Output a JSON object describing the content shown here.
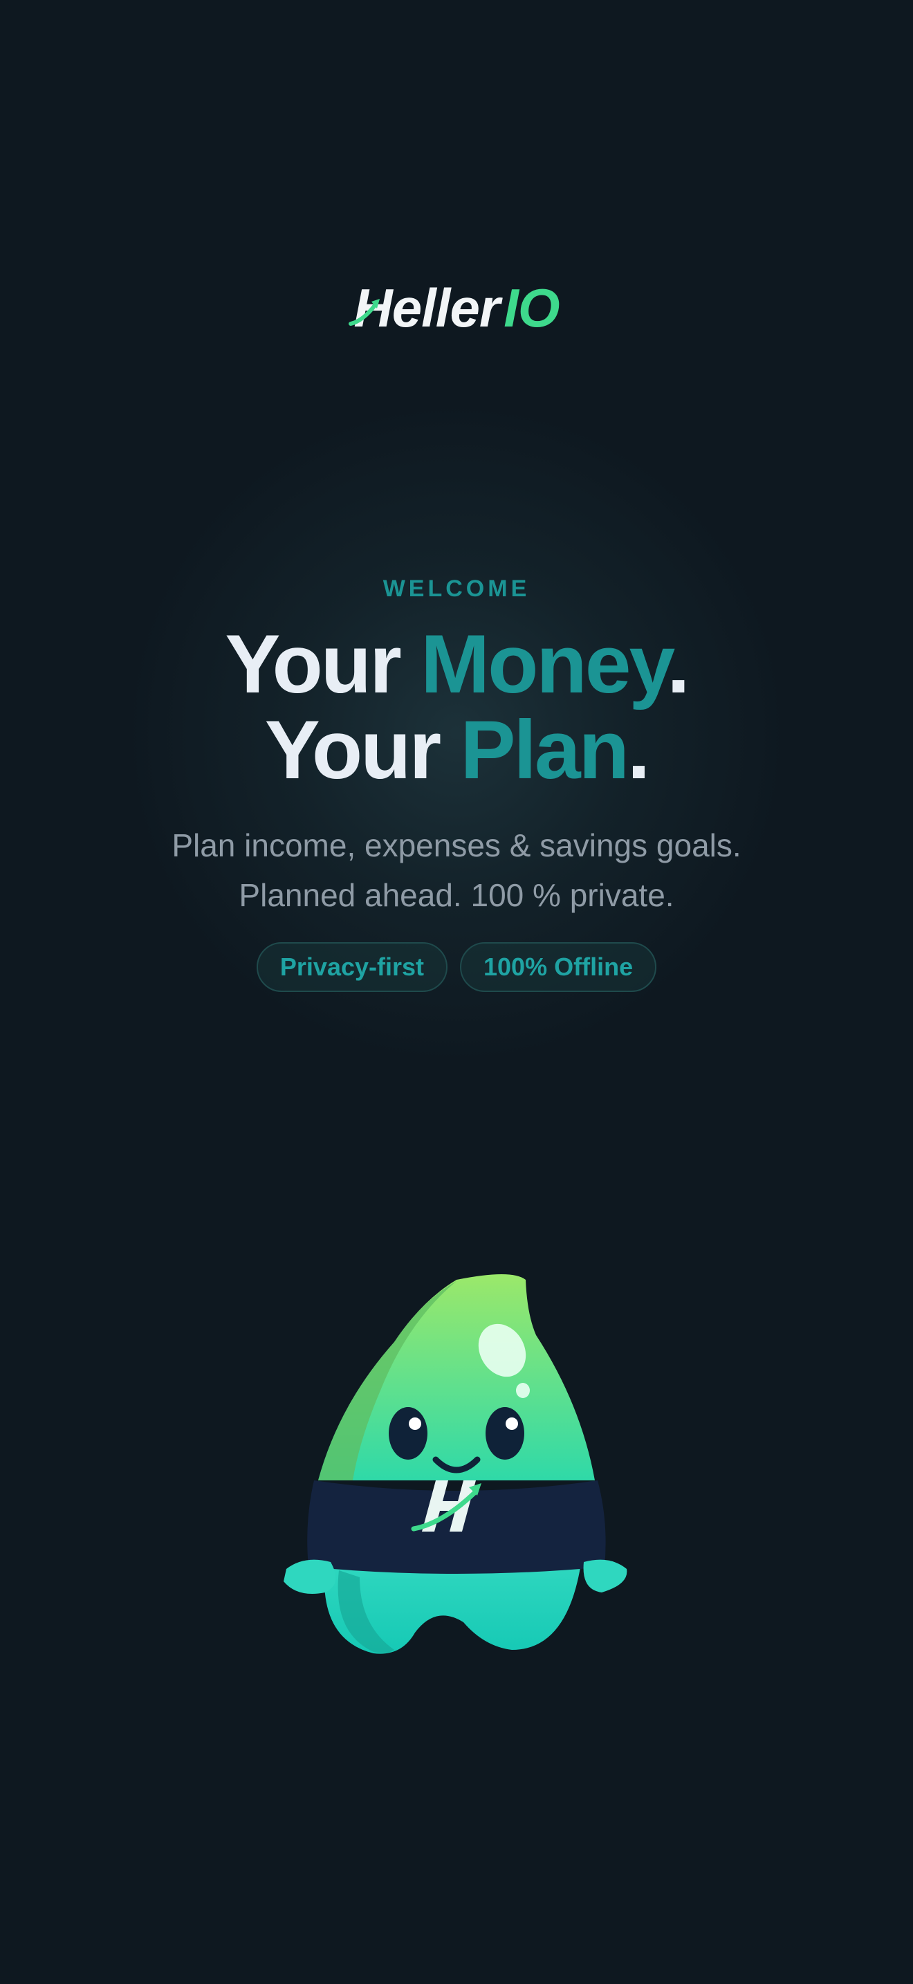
{
  "brand": {
    "name_part1": "Heller",
    "name_part2": "IO"
  },
  "hero": {
    "eyebrow": "WELCOME",
    "line1_word1": "Your",
    "line1_word2": "Money",
    "line1_dot": ".",
    "line2_word1": "Your",
    "line2_word2": "Plan",
    "line2_dot": ".",
    "subtitle_line1": "Plan income, expenses & savings goals.",
    "subtitle_line2": "Planned ahead. 100 % private."
  },
  "chips": [
    {
      "label": "Privacy-first"
    },
    {
      "label": "100% Offline"
    }
  ],
  "mascot": {
    "shirt_mark": "H"
  },
  "colors": {
    "background": "#0e1820",
    "accent_teal": "#1b9494",
    "brand_green": "#3ed98c",
    "headline_white": "#e8eef5",
    "subtitle_gray": "#8f9ba6"
  }
}
